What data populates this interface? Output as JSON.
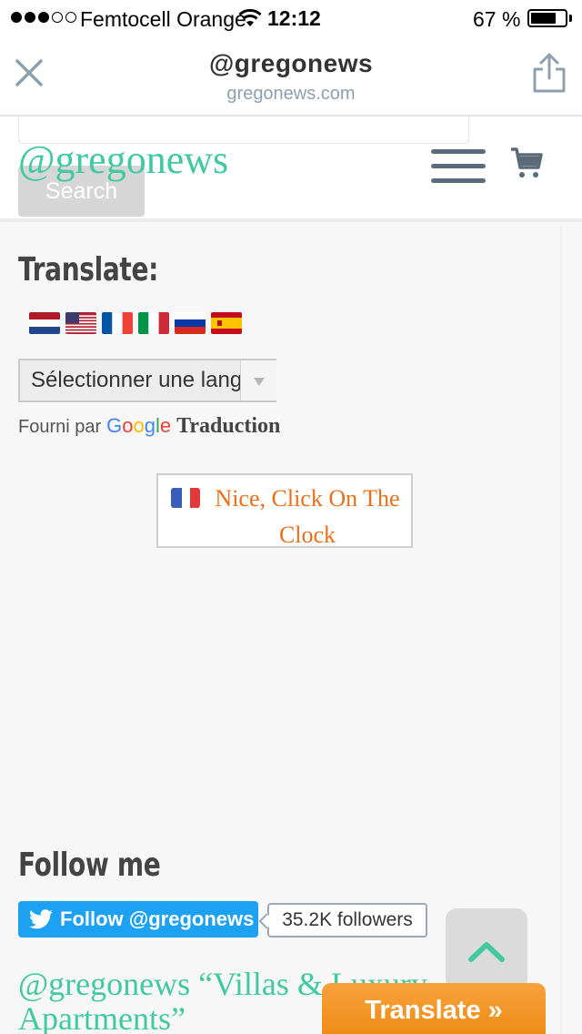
{
  "status_bar": {
    "carrier": "Femtocell Orange",
    "time": "12:12",
    "battery": "67 %"
  },
  "browser": {
    "title": "@gregonews",
    "url": "gregonews.com"
  },
  "site": {
    "logo": "@gregonews",
    "search_button": "Search"
  },
  "translate_widget": {
    "title": "Translate:",
    "flags": [
      "nl-flag",
      "us-flag",
      "fr-flag",
      "it-flag",
      "ru-flag",
      "es-flag"
    ],
    "select_value": "Sélectionner une langue",
    "powered_by": "Fourni par",
    "google": "Google",
    "service": "Traduction"
  },
  "promo": {
    "text": "Nice, Click On The Clock"
  },
  "follow": {
    "title": "Follow me",
    "button": "Follow @gregonews",
    "followers": "35.2K followers"
  },
  "post": {
    "title": "@gregonews “Villas & Luxury Apartments”"
  },
  "floating": {
    "translate_tab": "Translate »"
  },
  "colors": {
    "accent": "#42c9a0",
    "orange": "#e8701b",
    "twitter": "#1da1f2"
  }
}
